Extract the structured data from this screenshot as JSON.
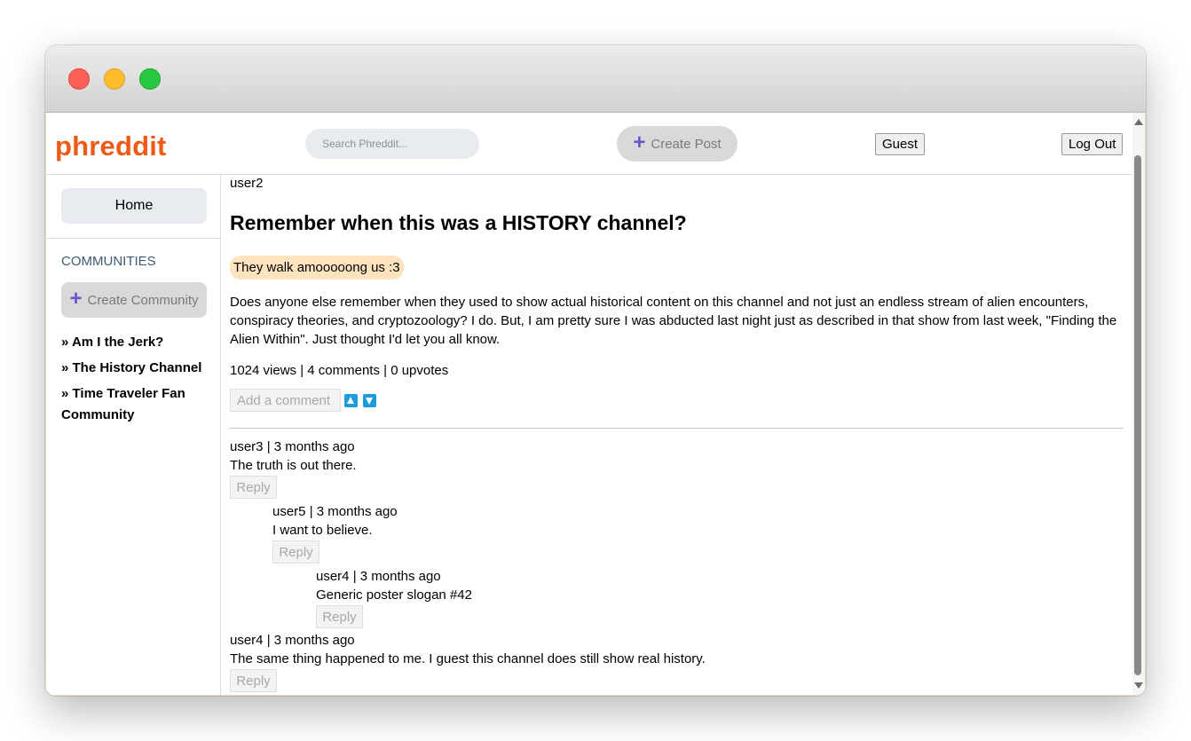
{
  "window": {
    "title": ""
  },
  "header": {
    "logo": "phreddit",
    "search_placeholder": "Search Phreddit...",
    "create_post_label": "Create Post",
    "guest_label": "Guest",
    "logout_label": "Log Out"
  },
  "sidebar": {
    "home_label": "Home",
    "communities_heading": "COMMUNITIES",
    "create_community_label": "Create Community",
    "communities": [
      "» Am I the Jerk?",
      "» The History Channel",
      "» Time Traveler Fan Community"
    ]
  },
  "post": {
    "author": "user2",
    "title": "Remember when this was a HISTORY channel?",
    "flair": "They walk amooooong us :3",
    "body": "Does anyone else remember when they used to show actual historical content on this channel and not just an endless stream of alien encounters, conspiracy theories, and cryptozoology? I do. But, I am pretty sure I was abducted last night just as described in that show from last week, \"Finding the Alien Within\". Just thought I'd let you all know.",
    "stats": "1024 views | 4 comments | 0 upvotes",
    "comment_placeholder": "Add a comment",
    "upvote_icon": "up-arrow-icon",
    "downvote_icon": "down-arrow-icon"
  },
  "comments": [
    {
      "meta": "user3 | 3 months ago",
      "text": "The truth is out there.",
      "reply_label": "Reply",
      "depth": 0
    },
    {
      "meta": "user5 | 3 months ago",
      "text": "I want to believe.",
      "reply_label": "Reply",
      "depth": 1
    },
    {
      "meta": "user4 | 3 months ago",
      "text": "Generic poster slogan #42",
      "reply_label": "Reply",
      "depth": 2
    },
    {
      "meta": "user4 | 3 months ago",
      "text": "The same thing happened to me. I guest this channel does still show real history.",
      "reply_label": "Reply",
      "depth": 0
    }
  ],
  "colors": {
    "brand": "#ef5a17",
    "vote_button": "#1e9bdb",
    "flair_bg": "#fde4bf",
    "plus_icon": "#6e53c8"
  }
}
